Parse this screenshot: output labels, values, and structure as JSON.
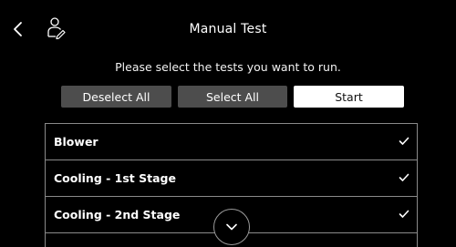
{
  "header": {
    "title": "Manual Test",
    "back_icon": "chevron-left-icon",
    "user_icon": "technician-icon"
  },
  "instruction": "Please select the tests you want to run.",
  "actions": {
    "deselect_label": "Deselect All",
    "select_label": "Select All",
    "start_label": "Start"
  },
  "tests": [
    {
      "label": "Blower",
      "checked": true
    },
    {
      "label": "Cooling - 1st Stage",
      "checked": true
    },
    {
      "label": "Cooling - 2nd Stage",
      "checked": true
    }
  ],
  "scroll_icon": "chevron-down-icon",
  "colors": {
    "background": "#000000",
    "button_dark": "#4d4d4d",
    "button_light": "#ffffff",
    "divider": "#8a8a8a"
  }
}
